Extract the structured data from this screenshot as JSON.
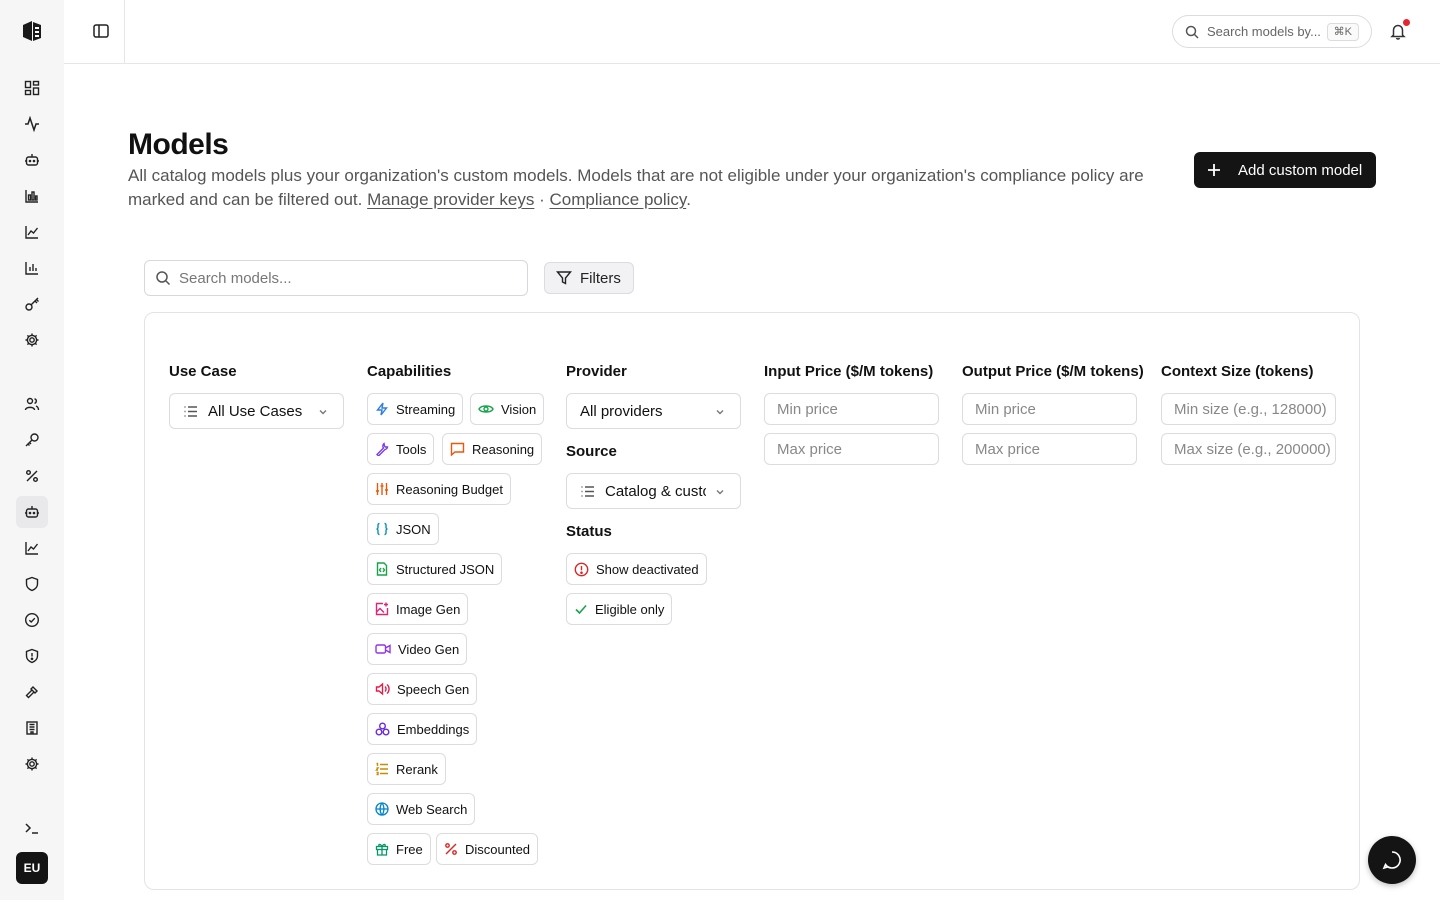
{
  "header": {
    "search_placeholder": "Search models by...",
    "search_shortcut": "⌘K"
  },
  "sidebar": {
    "avatar_initials": "EU",
    "icons": [
      "dashboard-icon",
      "activity-icon",
      "bot-icon",
      "bar-chart-icon",
      "line-chart-icon",
      "column-chart-icon",
      "key-icon",
      "settings-icon",
      "users-icon",
      "key-round-icon",
      "percent-icon",
      "bot-active-icon",
      "trend-icon",
      "shield-icon",
      "check-circle-icon",
      "shield-alert-icon",
      "hammer-icon",
      "building-icon",
      "cog-icon",
      "terminal-icon"
    ]
  },
  "page": {
    "title": "Models",
    "description": "All catalog models plus your organization's custom models. Models that are not eligible under your organization's compliance policy are marked and can be filtered out.",
    "link_provider_keys": "Manage provider keys",
    "separator": " · ",
    "link_compliance": "Compliance policy",
    "period": ".",
    "add_button": "Add custom model"
  },
  "toolbar": {
    "search_placeholder": "Search models...",
    "filters_label": "Filters"
  },
  "filters": {
    "use_case": {
      "label": "Use Case",
      "value": "All Use Cases"
    },
    "capabilities": {
      "label": "Capabilities",
      "chips": {
        "streaming": "Streaming",
        "vision": "Vision",
        "tools": "Tools",
        "reasoning": "Reasoning",
        "reasoning_budget": "Reasoning Budget",
        "json": "JSON",
        "structured_json": "Structured JSON",
        "image_gen": "Image Gen",
        "video_gen": "Video Gen",
        "speech_gen": "Speech Gen",
        "embeddings": "Embeddings",
        "rerank": "Rerank",
        "web_search": "Web Search",
        "free": "Free",
        "discounted": "Discounted"
      }
    },
    "provider": {
      "label": "Provider",
      "value": "All providers"
    },
    "source": {
      "label": "Source",
      "value": "Catalog & custom"
    },
    "status": {
      "label": "Status",
      "show_deactivated": "Show deactivated",
      "eligible_only": "Eligible only"
    },
    "input_price": {
      "label": "Input Price ($/M tokens)",
      "min_placeholder": "Min price",
      "max_placeholder": "Max price"
    },
    "output_price": {
      "label": "Output Price ($/M tokens)",
      "min_placeholder": "Min price",
      "max_placeholder": "Max price"
    },
    "context_size": {
      "label": "Context Size (tokens)",
      "min_placeholder": "Min size (e.g., 128000)",
      "max_placeholder": "Max size (e.g., 200000)"
    }
  },
  "colors": {
    "primary_button": "#141414",
    "notification_dot": "#e5262f",
    "streaming": "#2f7de1",
    "vision": "#16a34a",
    "tools": "#7c3aed",
    "reasoning": "#ea580c",
    "json": "#0891b2",
    "image_gen": "#db2777",
    "video_gen": "#9333ea",
    "speech_gen": "#e11d48",
    "embeddings": "#6d28d9",
    "rerank": "#ca8a04",
    "web_search": "#0284c7",
    "free": "#059669",
    "discounted": "#dc2626"
  }
}
